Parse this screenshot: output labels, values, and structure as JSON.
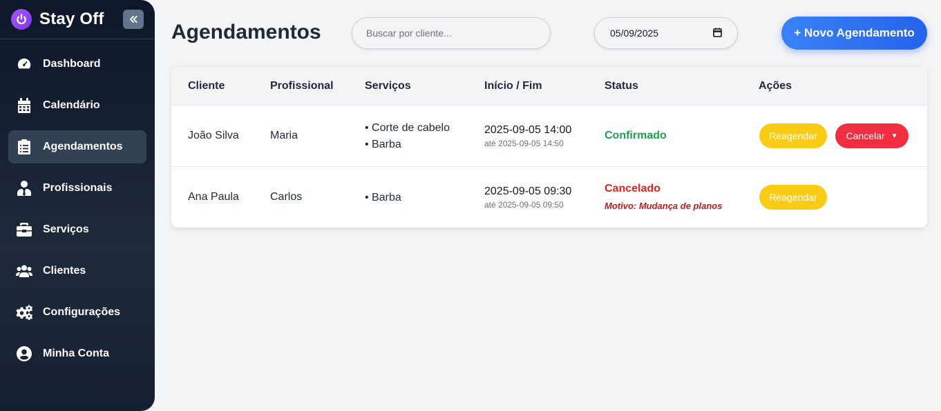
{
  "app": {
    "name": "Stay Off"
  },
  "sidebar": {
    "items": [
      {
        "label": "Dashboard",
        "icon": "gauge-icon",
        "active": false
      },
      {
        "label": "Calendário",
        "icon": "calendar-icon",
        "active": false
      },
      {
        "label": "Agendamentos",
        "icon": "clipboard-icon",
        "active": true
      },
      {
        "label": "Profissionais",
        "icon": "user-tie-icon",
        "active": false
      },
      {
        "label": "Serviços",
        "icon": "briefcase-icon",
        "active": false
      },
      {
        "label": "Clientes",
        "icon": "users-icon",
        "active": false
      },
      {
        "label": "Configurações",
        "icon": "gears-icon",
        "active": false
      },
      {
        "label": "Minha Conta",
        "icon": "user-circle-icon",
        "active": false
      }
    ]
  },
  "header": {
    "title": "Agendamentos",
    "search_placeholder": "Buscar por cliente...",
    "search_value": "",
    "date_value": "05/09/2025",
    "new_button": "+ Novo Agendamento"
  },
  "table": {
    "columns": [
      "Cliente",
      "Profissional",
      "Serviços",
      "Início / Fim",
      "Status",
      "Ações"
    ],
    "rows": [
      {
        "cliente": "João Silva",
        "profissional": "Maria",
        "servicos": [
          "Corte de cabelo",
          "Barba"
        ],
        "inicio": "2025-09-05 14:00",
        "fim": "até 2025-09-05 14:50",
        "status": "Confirmado",
        "motivo": "",
        "actions": {
          "reschedule": "Reagendar",
          "cancel": "Cancelar"
        }
      },
      {
        "cliente": "Ana Paula",
        "profissional": "Carlos",
        "servicos": [
          "Barba"
        ],
        "inicio": "2025-09-05 09:30",
        "fim": "até 2025-09-05 09:50",
        "status": "Cancelado",
        "motivo": "Motivo: Mudança de planos",
        "actions": {
          "reschedule": "Reagendar"
        }
      }
    ]
  },
  "colors": {
    "sidebar_bg": "#0f172a",
    "accent_blue": "#2563eb",
    "status_confirmed": "#16a34a",
    "status_cancelled": "#dc2626",
    "reschedule_btn": "#facc15",
    "cancel_btn": "#ef2f3f",
    "brand_purple": "#a855f7"
  }
}
